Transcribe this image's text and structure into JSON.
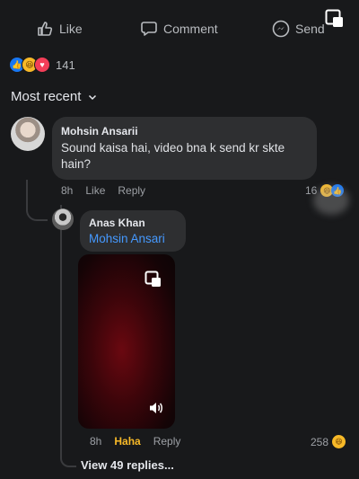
{
  "actions": {
    "like": "Like",
    "comment": "Comment",
    "send": "Send"
  },
  "reactions": {
    "count": "141"
  },
  "sort": {
    "label": "Most recent"
  },
  "comment": {
    "author": "Mohsin Ansarii",
    "text": "Sound kaisa hai, video bna k send kr skte hain?",
    "time": "8h",
    "like_label": "Like",
    "reply_label": "Reply",
    "reaction_count": "16"
  },
  "reply": {
    "author": "Anas Khan",
    "mention": "Mohsin Ansari",
    "time": "8h",
    "reaction_label": "Haha",
    "reply_label": "Reply",
    "reaction_count": "258"
  },
  "view_replies": "View 49 replies...",
  "colors": {
    "background": "#18191b",
    "bubble": "#2e2f31",
    "link": "#4599ff",
    "haha": "#f7b928",
    "like": "#1877f2"
  }
}
